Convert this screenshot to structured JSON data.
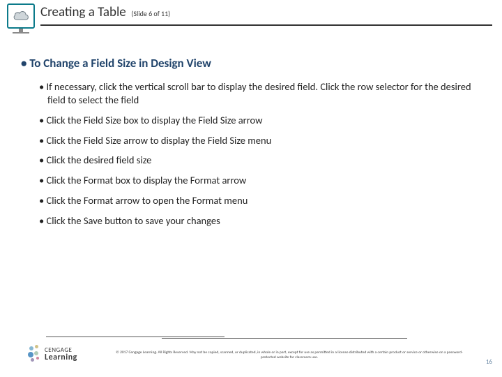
{
  "header": {
    "title": "Creating a Table",
    "slide_count": "(Slide 6 of 11)",
    "icon": "cloud-icon"
  },
  "body": {
    "heading": "To Change a Field Size in Design View",
    "bullets": [
      "If necessary, click the vertical scroll bar to display the desired field. Click the row selector for the desired field to select the field",
      "Click the Field Size box to display the Field Size arrow",
      "Click the Field Size arrow to display the Field Size menu",
      "Click the desired field size",
      "Click the Format box to display the Format arrow",
      "Click the Format arrow to open the Format menu",
      "Click the Save button to save your changes"
    ]
  },
  "footer": {
    "brand_line1": "CENGAGE",
    "brand_line2": "Learning",
    "copyright": "© 2017 Cengage Learning. All Rights Reserved. May not be copied, scanned, or duplicated, in whole or in part, except for use as permitted in a license distributed with a certain product or service or otherwise on a password-protected website for classroom use.",
    "page_number": "16"
  }
}
